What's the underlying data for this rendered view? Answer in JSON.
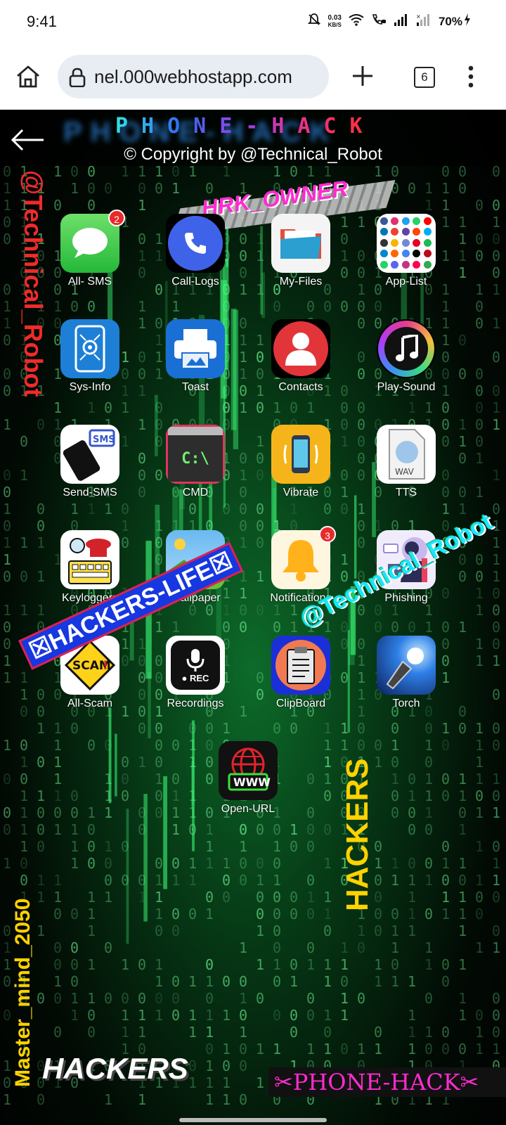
{
  "status_bar": {
    "time": "9:41",
    "net_speed_value": "0.03",
    "net_speed_unit": "KB/S",
    "battery": "70%"
  },
  "browser": {
    "url": "nel.000webhostapp.com",
    "tab_count": "6"
  },
  "page": {
    "title": "PHONE-HACK",
    "copyright": "© Copyright by @Technical_Robot",
    "overlays": {
      "side_handle": "@Technical_Robot",
      "owner": "HRK_OWNER",
      "hackers_life": "☒HACKERS-LIFE☒",
      "diag_handle": "@Technical_Robot",
      "hackers_yellow": "HACKERS",
      "mastermind": "Master_mind_2050",
      "hackers_white": "HACKERS",
      "phone_hack_bottom": "✂PHONE-HACK✂"
    },
    "apps": [
      {
        "label": "All- SMS",
        "icon": "messages-icon",
        "badge": "2"
      },
      {
        "label": "Call-Logs",
        "icon": "phone-icon"
      },
      {
        "label": "My-Files",
        "icon": "folder-icon"
      },
      {
        "label": "App-List",
        "icon": "apps-grid-icon"
      },
      {
        "label": "Sys-Info",
        "icon": "system-info-icon"
      },
      {
        "label": "Toast",
        "icon": "printer-icon"
      },
      {
        "label": "Contacts",
        "icon": "contact-icon"
      },
      {
        "label": "Play-Sound",
        "icon": "music-icon"
      },
      {
        "label": "Send-SMS",
        "icon": "sms-phone-icon"
      },
      {
        "label": "CMD",
        "icon": "terminal-icon"
      },
      {
        "label": "Vibrate",
        "icon": "vibrate-icon"
      },
      {
        "label": "TTS",
        "icon": "wav-file-icon"
      },
      {
        "label": "Keyloggers",
        "icon": "keylogger-icon"
      },
      {
        "label": "Wallpaper",
        "icon": "image-icon"
      },
      {
        "label": "Notifications",
        "icon": "bell-icon",
        "badge": "3"
      },
      {
        "label": "Phishing",
        "icon": "hacker-laptop-icon"
      },
      {
        "label": "All-Scam",
        "icon": "scam-sign-icon"
      },
      {
        "label": "Recordings",
        "icon": "microphone-rec-icon"
      },
      {
        "label": "ClipBoard",
        "icon": "clipboard-icon"
      },
      {
        "label": "Torch",
        "icon": "flashlight-icon"
      },
      {
        "label": "Open-URL",
        "icon": "www-globe-icon"
      }
    ]
  }
}
